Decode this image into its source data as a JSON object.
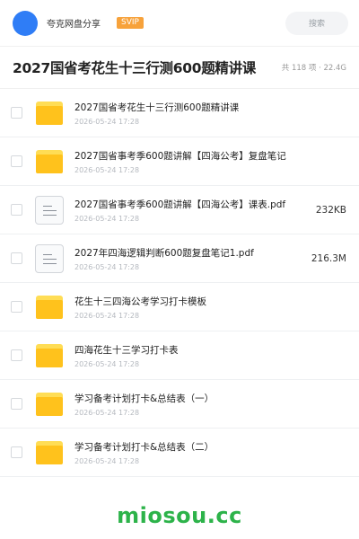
{
  "header": {
    "owner_name": "夸克网盘分享",
    "badge": "SVIP",
    "search_placeholder": "搜索"
  },
  "share": {
    "title": "2027国省考花生十三行测600题精讲课",
    "meta": "共 118 项 · 22.4G"
  },
  "files": [
    {
      "type": "folder",
      "name": "2027国省考花生十三行测600题精讲课",
      "date": "2026-05-24 17:28",
      "size": ""
    },
    {
      "type": "folder",
      "name": "2027国省事考季600题讲解【四海公考】复盘笔记",
      "date": "2026-05-24 17:28",
      "size": ""
    },
    {
      "type": "doc",
      "name": "2027国省事考季600题讲解【四海公考】课表.pdf",
      "date": "2026-05-24 17:28",
      "size": "232KB"
    },
    {
      "type": "doc",
      "name": "2027年四海逻辑判断600题复盘笔记1.pdf",
      "date": "2026-05-24 17:28",
      "size": "216.3M"
    },
    {
      "type": "folder",
      "name": "花生十三四海公考学习打卡模板",
      "date": "2026-05-24 17:28",
      "size": ""
    },
    {
      "type": "folder",
      "name": "四海花生十三学习打卡表",
      "date": "2026-05-24 17:28",
      "size": ""
    },
    {
      "type": "folder",
      "name": "学习备考计划打卡&总结表（一）",
      "date": "2026-05-24 17:28",
      "size": ""
    },
    {
      "type": "folder",
      "name": "学习备考计划打卡&总结表（二）",
      "date": "2026-05-24 17:28",
      "size": ""
    }
  ],
  "watermark": "miosou.cc",
  "colors": {
    "avatar": "#2f7df6",
    "badge": "#f7a23b",
    "folder": "#ffc21c",
    "watermark": "#2db34a"
  }
}
